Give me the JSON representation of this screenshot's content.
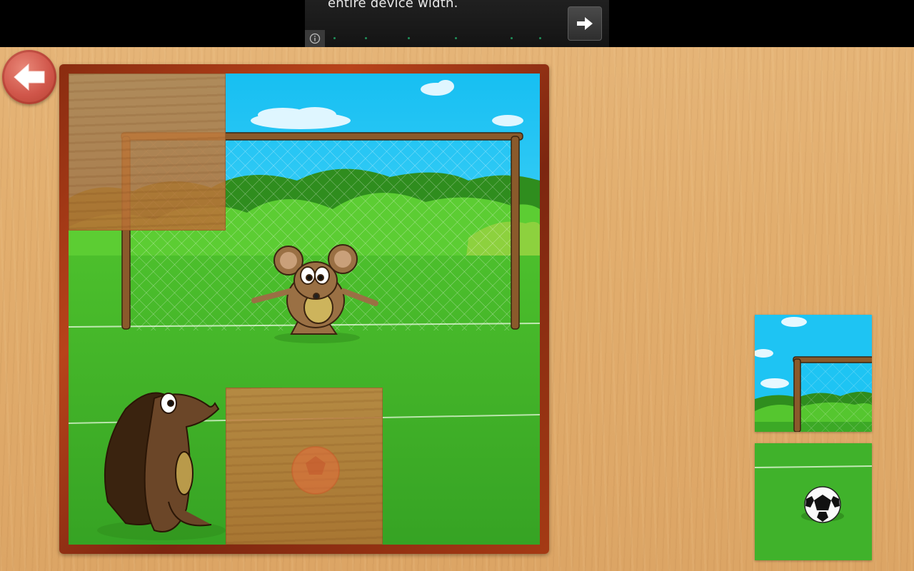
{
  "ad": {
    "text": "entire device width.",
    "info_icon": "info-icon",
    "next_icon": "arrow-right-icon"
  },
  "back_button": {
    "icon": "arrow-left-icon"
  },
  "puzzle": {
    "rows": 3,
    "cols": 3,
    "empty_slots": [
      {
        "row": 0,
        "col": 0
      },
      {
        "row": 2,
        "col": 1
      }
    ],
    "loose_pieces": [
      {
        "name": "sky-goalpost-piece"
      },
      {
        "name": "ball-grass-piece"
      }
    ]
  },
  "colors": {
    "sky": "#18c3f2",
    "grass": "#3fb12a",
    "board_frame": "#9a3514",
    "back_button": "#d0564a"
  }
}
